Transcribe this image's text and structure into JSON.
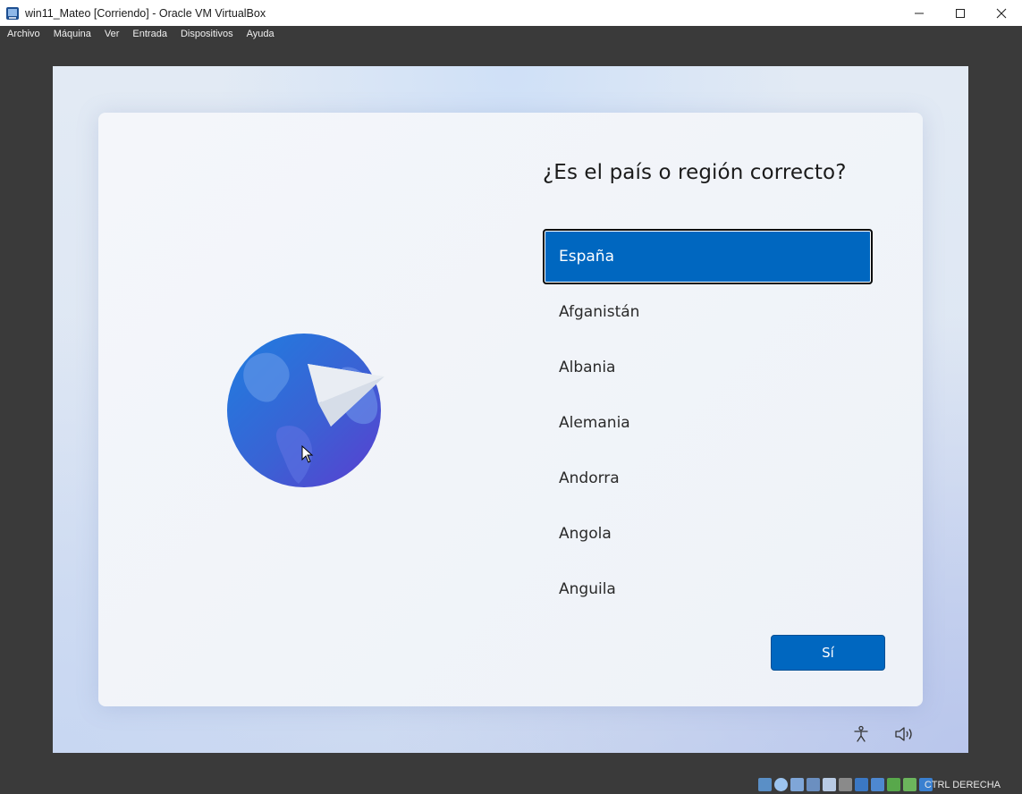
{
  "window": {
    "title": "win11_Mateo [Corriendo] - Oracle VM VirtualBox",
    "controls": [
      "minimize",
      "maximize",
      "close"
    ]
  },
  "menu": [
    "Archivo",
    "Máquina",
    "Ver",
    "Entrada",
    "Dispositivos",
    "Ayuda"
  ],
  "setup": {
    "heading": "¿Es el país o región correcto?",
    "regions": [
      "España",
      "Afganistán",
      "Albania",
      "Alemania",
      "Andorra",
      "Angola",
      "Anguila"
    ],
    "selected": "España",
    "confirm_label": "Sí",
    "bottom_icons": [
      "accessibility-icon",
      "volume-icon"
    ]
  },
  "statusbar": {
    "icons": [
      "optical-drive-icon",
      "audio-icon",
      "network-icon",
      "usb-icon",
      "shared-folders-icon",
      "capture-icon",
      "display-icon",
      "recording-icon",
      "clipboard-icon",
      "drag-drop-icon",
      "virtualization-icon",
      "mouse-integration-icon"
    ],
    "host_key": "CTRL DERECHA"
  },
  "colors": {
    "accent": "#0067c0",
    "titlebar": "#ffffff",
    "chrome": "#3a3a3a"
  }
}
